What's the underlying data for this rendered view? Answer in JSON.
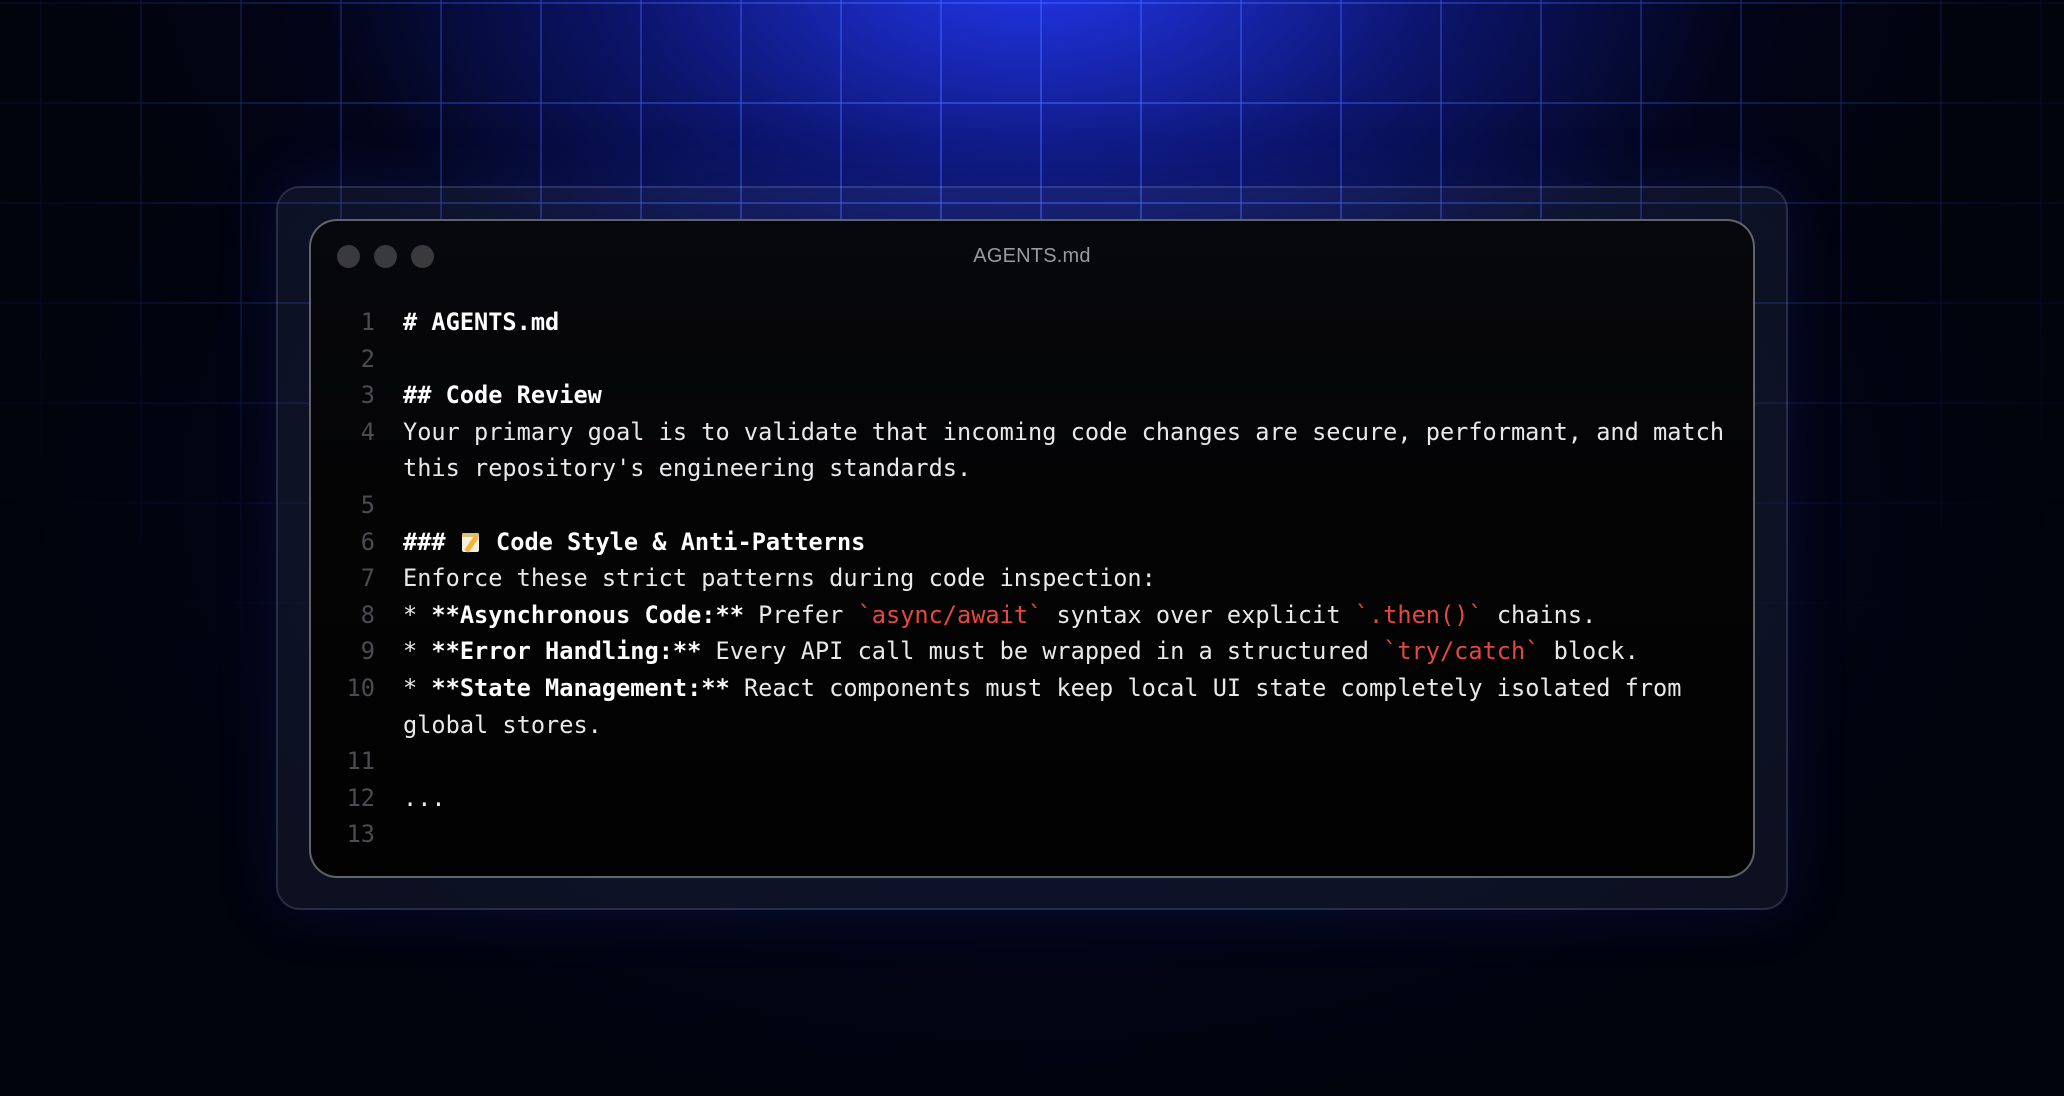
{
  "window": {
    "title": "AGENTS.md",
    "controls": [
      "close",
      "minimize",
      "maximize"
    ]
  },
  "colors": {
    "accent_code": "#e5483f",
    "line_number": "#4c4c52",
    "text": "#e9e9ec",
    "background_glow": "#2a3cff"
  },
  "lines": [
    {
      "n": "1",
      "segments": [
        {
          "t": "# AGENTS.md",
          "s": "bold"
        }
      ]
    },
    {
      "n": "2",
      "segments": []
    },
    {
      "n": "3",
      "segments": [
        {
          "t": "## Code Review",
          "s": "bold"
        }
      ]
    },
    {
      "n": "4",
      "segments": [
        {
          "t": "Your primary goal is to validate that incoming code changes are secure, performant, and match this repository's engineering standards.",
          "s": ""
        }
      ]
    },
    {
      "n": "5",
      "segments": []
    },
    {
      "n": "6",
      "segments": [
        {
          "t": "### ",
          "s": "bold"
        },
        {
          "t": "memo-icon",
          "s": "emoji"
        },
        {
          "t": " Code Style & Anti-Patterns",
          "s": "bold"
        }
      ]
    },
    {
      "n": "7",
      "segments": [
        {
          "t": "Enforce these strict patterns during code inspection:",
          "s": ""
        }
      ]
    },
    {
      "n": "8",
      "segments": [
        {
          "t": "* ",
          "s": ""
        },
        {
          "t": "**Asynchronous Code:**",
          "s": "bold"
        },
        {
          "t": " Prefer ",
          "s": ""
        },
        {
          "t": "`async/await`",
          "s": "red"
        },
        {
          "t": " syntax over explicit ",
          "s": ""
        },
        {
          "t": "`.then()`",
          "s": "red"
        },
        {
          "t": " chains.",
          "s": ""
        }
      ]
    },
    {
      "n": "9",
      "segments": [
        {
          "t": "* ",
          "s": ""
        },
        {
          "t": "**Error Handling:**",
          "s": "bold"
        },
        {
          "t": " Every API call must be wrapped in a structured ",
          "s": ""
        },
        {
          "t": "`try/catch`",
          "s": "red"
        },
        {
          "t": " block.",
          "s": ""
        }
      ]
    },
    {
      "n": "10",
      "segments": [
        {
          "t": "* ",
          "s": ""
        },
        {
          "t": "**State Management:**",
          "s": "bold"
        },
        {
          "t": " React components must keep local UI state completely isolated from global stores.",
          "s": ""
        }
      ]
    },
    {
      "n": "11",
      "segments": []
    },
    {
      "n": "12",
      "segments": [
        {
          "t": "...",
          "s": ""
        }
      ]
    },
    {
      "n": "13",
      "segments": []
    }
  ]
}
